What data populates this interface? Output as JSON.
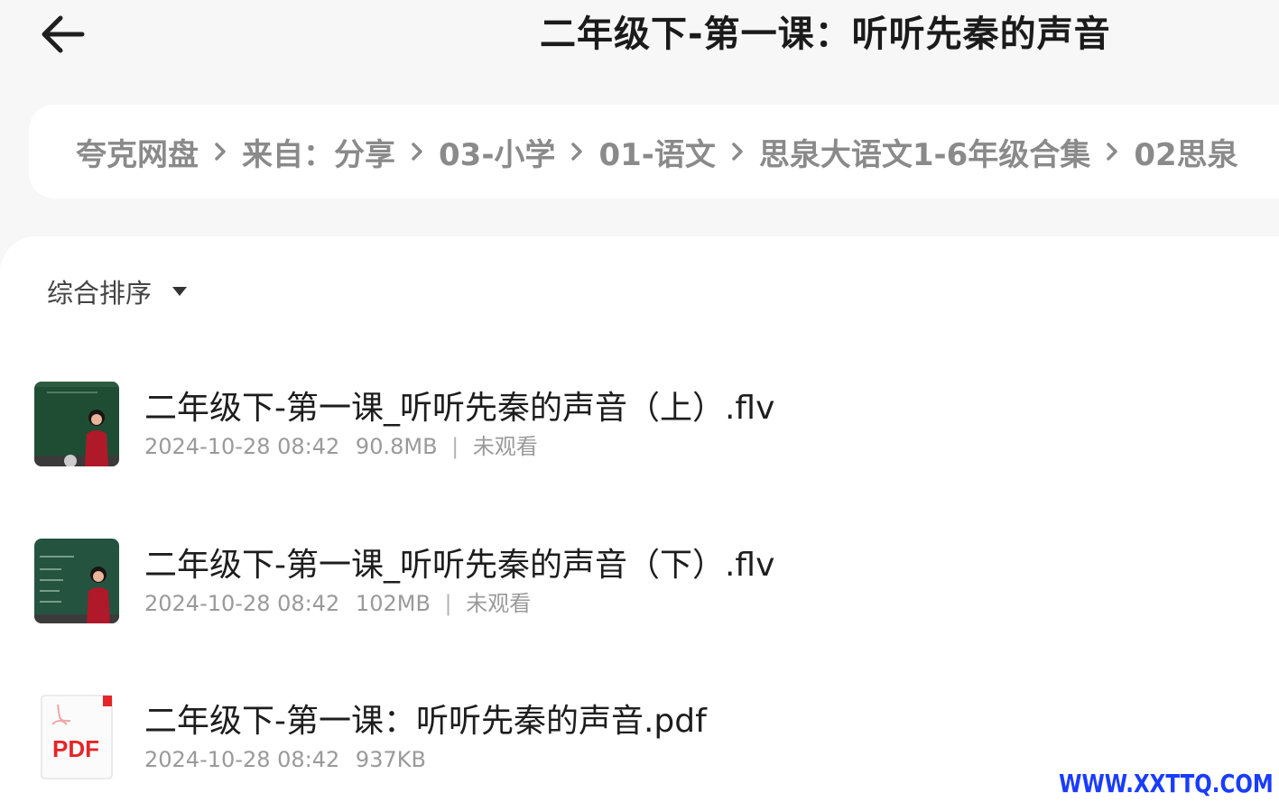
{
  "header": {
    "title": "二年级下-第一课：听听先秦的声音"
  },
  "breadcrumb": {
    "items": [
      "夸克网盘",
      "来自：分享",
      "03-小学",
      "01-语文",
      "思泉大语文1-6年级合集",
      "02思泉"
    ]
  },
  "sort": {
    "label": "综合排序"
  },
  "files": [
    {
      "name": "二年级下-第一课_听听先秦的声音（上）.flv",
      "date": "2024-10-28 08:42",
      "size": "90.8MB",
      "status": "未观看",
      "type": "video"
    },
    {
      "name": "二年级下-第一课_听听先秦的声音（下）.flv",
      "date": "2024-10-28 08:42",
      "size": "102MB",
      "status": "未观看",
      "type": "video"
    },
    {
      "name": "二年级下-第一课：听听先秦的声音.pdf",
      "date": "2024-10-28 08:42",
      "size": "937KB",
      "status": "",
      "type": "pdf"
    }
  ],
  "pdf_icon_label": "PDF",
  "watermark": "WWW.XXTTQ.COM",
  "colors": {
    "background": "#f7f7f7",
    "panel": "#ffffff",
    "pdf_red": "#e5252a",
    "chalkboard": "#1f4d34"
  }
}
